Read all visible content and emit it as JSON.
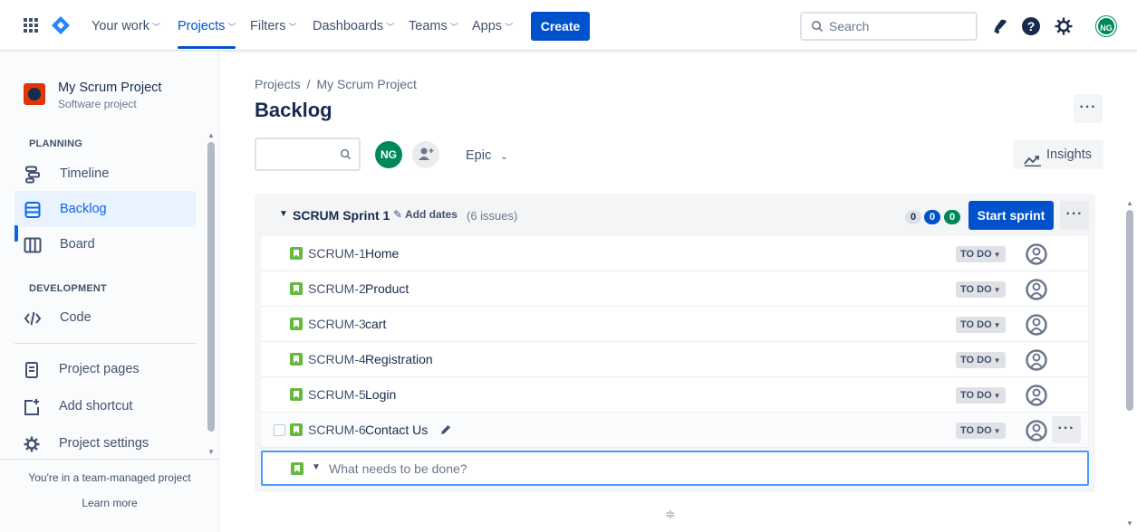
{
  "topbar": {
    "nav": [
      {
        "label": "Your work",
        "active": false
      },
      {
        "label": "Projects",
        "active": true
      },
      {
        "label": "Filters",
        "active": false
      },
      {
        "label": "Dashboards",
        "active": false
      },
      {
        "label": "Teams",
        "active": false
      },
      {
        "label": "Apps",
        "active": false
      }
    ],
    "create_label": "Create",
    "search_placeholder": "Search",
    "user_initials": "NG",
    "icons": [
      "app-switcher-icon",
      "jira-logo-icon",
      "notifications-icon",
      "help-icon",
      "settings-icon"
    ]
  },
  "sidebar": {
    "project_name": "My Scrum Project",
    "project_type": "Software project",
    "planning_heading": "PLANNING",
    "planning_items": [
      {
        "label": "Timeline",
        "icon": "timeline-icon"
      },
      {
        "label": "Backlog",
        "icon": "backlog-icon",
        "selected": true
      },
      {
        "label": "Board",
        "icon": "board-icon"
      }
    ],
    "development_heading": "DEVELOPMENT",
    "development_items": [
      {
        "label": "Code",
        "icon": "code-icon"
      }
    ],
    "other_items": [
      {
        "label": "Project pages",
        "icon": "page-icon"
      },
      {
        "label": "Add shortcut",
        "icon": "add-shortcut-icon"
      },
      {
        "label": "Project settings",
        "icon": "gear-icon"
      }
    ],
    "team_note": "You're in a team-managed project",
    "learn_more": "Learn more"
  },
  "main": {
    "breadcrumb": [
      "Projects",
      "My Scrum Project"
    ],
    "breadcrumb_sep": "/",
    "title": "Backlog",
    "filter_avatar": "NG",
    "epic_label": "Epic",
    "insights_label": "Insights"
  },
  "sprint": {
    "name": "SCRUM Sprint 1",
    "add_dates": "Add dates",
    "issue_count": "(6 issues)",
    "counts": {
      "todo": "0",
      "in_progress": "0",
      "done": "0"
    },
    "start_label": "Start sprint",
    "issues": [
      {
        "key": "SCRUM-1",
        "summary": "Home",
        "status": "TO DO"
      },
      {
        "key": "SCRUM-2",
        "summary": "Product",
        "status": "TO DO"
      },
      {
        "key": "SCRUM-3",
        "summary": "cart",
        "status": "TO DO"
      },
      {
        "key": "SCRUM-4",
        "summary": "Registration",
        "status": "TO DO"
      },
      {
        "key": "SCRUM-5",
        "summary": "Login",
        "status": "TO DO"
      },
      {
        "key": "SCRUM-6",
        "summary": "Contact Us",
        "status": "TO DO"
      }
    ],
    "create_placeholder": "What needs to be done?"
  },
  "colors": {
    "brand_blue": "#0052CC",
    "story_green": "#63BA3C",
    "avatar_green": "#00875A"
  }
}
